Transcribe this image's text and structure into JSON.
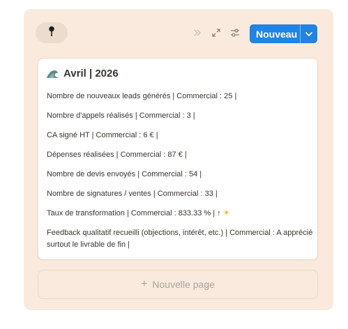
{
  "toolbar": {
    "pin_icon": "pushpin-icon",
    "icons": [
      "double-chevron-right-icon",
      "expand-icon",
      "filter-settings-icon"
    ],
    "new_button_label": "Nouveau",
    "new_button_color": "#2383e2"
  },
  "card": {
    "icon": "wave-icon",
    "title": "Avril | 2026",
    "lines": [
      "Nombre de nouveaux leads générés | Commercial : 25 |",
      "Nombre d'appels réalisés | Commercial : 3 |",
      "CA signé HT  | Commercial : 6 € |",
      "Dépenses réalisées  | Commercial : 87 € |",
      "Nombre de devis envoyés | Commercial : 54 |",
      "Nombre de signatures / ventes  | Commercial : 33 |",
      "Taux de transformation | Commercial : 833.33 % |  ↑",
      "Feedback qualitatif recueilli (objections, intérêt, etc.)  | Commercial : A apprécié surtout le livrable de fin |"
    ],
    "sun_emoji": "☀"
  },
  "new_page": {
    "plus": "+",
    "label": "Nouvelle page"
  },
  "colors": {
    "panel_bg": "#f9eadd",
    "pin_bg": "#ecdccd",
    "accent": "#2383e2"
  }
}
